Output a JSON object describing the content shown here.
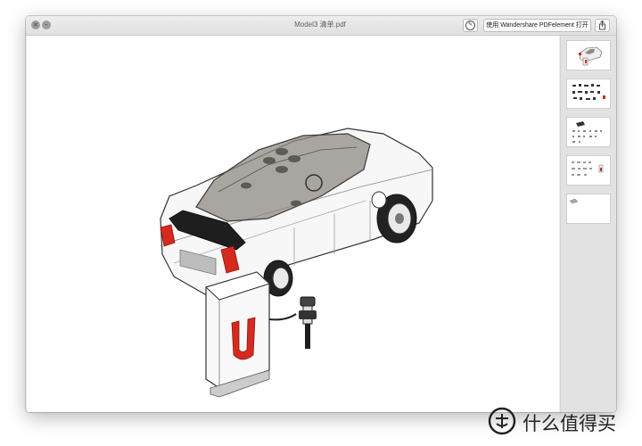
{
  "window": {
    "title": "Model3 清单.pdf",
    "open_with_label": "使用 Wandershare PDFelement 打开"
  },
  "toolbar": {
    "markup_icon": "markup-pen-icon",
    "share_icon": "share-icon"
  },
  "sidebar": {
    "thumbnails": [
      {
        "page": 1,
        "description": "car-cover"
      },
      {
        "page": 2,
        "description": "parts-list"
      },
      {
        "page": 3,
        "description": "parts-list"
      },
      {
        "page": 4,
        "description": "parts-list"
      },
      {
        "page": 5,
        "description": "single-part"
      }
    ]
  },
  "document": {
    "content": "LEGO-style white Tesla Model 3 car with charging station illustration"
  },
  "watermark": {
    "text": "什么值得买"
  }
}
